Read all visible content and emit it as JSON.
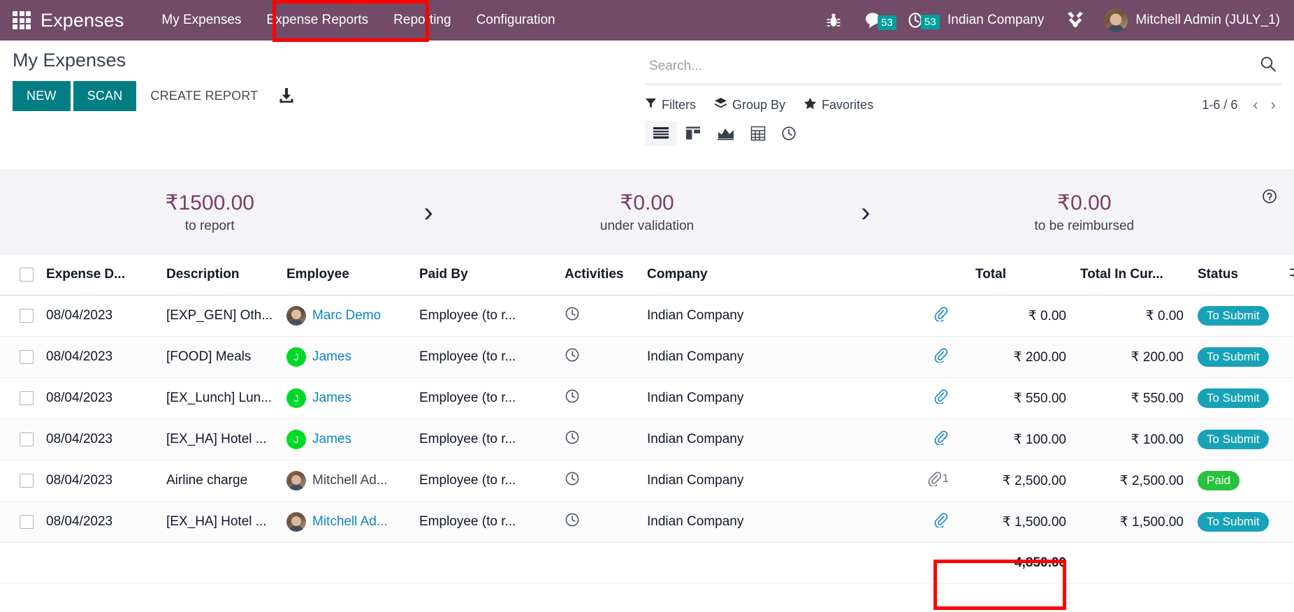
{
  "navbar": {
    "apps_icon": "apps-grid-icon",
    "brand": "Expenses",
    "menu": [
      {
        "label": "My Expenses",
        "active": false
      },
      {
        "label": "Expense Reports",
        "active": true
      },
      {
        "label": "Reporting",
        "active": false
      },
      {
        "label": "Configuration",
        "active": false
      }
    ],
    "bug_icon": "bug-icon",
    "messages": {
      "icon": "chat-bubble-icon",
      "count": "53"
    },
    "activities": {
      "icon": "clock-icon",
      "count": "53"
    },
    "company": "Indian Company",
    "tools_icon": "wrench-screwdriver-icon",
    "user": {
      "avatar": "user-avatar",
      "name": "Mitchell Admin (JULY_1)"
    }
  },
  "control_panel": {
    "title": "My Expenses",
    "buttons": {
      "new": "NEW",
      "scan": "SCAN",
      "create_report": "CREATE REPORT",
      "upload_icon": "upload-download-icon"
    },
    "search": {
      "placeholder": "Search...",
      "value": "",
      "icon": "search-icon"
    },
    "filters": [
      {
        "label": "Filters",
        "icon": "funnel-icon"
      },
      {
        "label": "Group By",
        "icon": "layers-icon"
      },
      {
        "label": "Favorites",
        "icon": "star-icon"
      }
    ],
    "pager": {
      "text": "1-6 / 6",
      "prev_icon": "chevron-left-icon",
      "next_icon": "chevron-right-icon"
    },
    "views": [
      {
        "name": "list",
        "icon": "list-view-icon",
        "active": true
      },
      {
        "name": "kanban",
        "icon": "kanban-view-icon",
        "active": false
      },
      {
        "name": "graph",
        "icon": "graph-view-icon",
        "active": false
      },
      {
        "name": "pivot",
        "icon": "pivot-view-icon",
        "active": false
      },
      {
        "name": "activity",
        "icon": "activity-view-icon",
        "active": false
      }
    ]
  },
  "stats": {
    "separator": "›",
    "help_icon": "help-circle-icon",
    "items": [
      {
        "value": "₹1500.00",
        "label": "to report"
      },
      {
        "value": "₹0.00",
        "label": "under validation"
      },
      {
        "value": "₹0.00",
        "label": "to be reimbursed"
      }
    ]
  },
  "table": {
    "headers": {
      "select_all": "select-all-checkbox",
      "date": "Expense D...",
      "description": "Description",
      "employee": "Employee",
      "paid_by": "Paid By",
      "activities": "Activities",
      "company": "Company",
      "attachments": "",
      "total": "Total",
      "total_in_currency": "Total In Cur...",
      "status": "Status",
      "options_icon": "column-options-icon"
    },
    "rows": [
      {
        "date": "08/04/2023",
        "description": "[EXP_GEN] Oth...",
        "employee": "Marc Demo",
        "employee_avatar": "photo-marc",
        "paid_by": "Employee (to r...",
        "activity_icon": "clock-icon",
        "company": "Indian Company",
        "attachment_icon": "paperclip-icon",
        "attachment_count": "",
        "total": "₹ 0.00",
        "total_in_currency": "₹ 0.00",
        "status": "To Submit",
        "status_type": "tosubmit",
        "read": false
      },
      {
        "date": "08/04/2023",
        "description": "[FOOD] Meals",
        "employee": "James",
        "employee_avatar": "initial-J",
        "paid_by": "Employee (to r...",
        "activity_icon": "clock-icon",
        "company": "Indian Company",
        "attachment_icon": "paperclip-icon",
        "attachment_count": "",
        "total": "₹ 200.00",
        "total_in_currency": "₹ 200.00",
        "status": "To Submit",
        "status_type": "tosubmit",
        "read": false
      },
      {
        "date": "08/04/2023",
        "description": "[EX_Lunch] Lun...",
        "employee": "James",
        "employee_avatar": "initial-J",
        "paid_by": "Employee (to r...",
        "activity_icon": "clock-icon",
        "company": "Indian Company",
        "attachment_icon": "paperclip-icon",
        "attachment_count": "",
        "total": "₹ 550.00",
        "total_in_currency": "₹ 550.00",
        "status": "To Submit",
        "status_type": "tosubmit",
        "read": false
      },
      {
        "date": "08/04/2023",
        "description": "[EX_HA] Hotel ...",
        "employee": "James",
        "employee_avatar": "initial-J",
        "paid_by": "Employee (to r...",
        "activity_icon": "clock-icon",
        "company": "Indian Company",
        "attachment_icon": "paperclip-icon",
        "attachment_count": "",
        "total": "₹ 100.00",
        "total_in_currency": "₹ 100.00",
        "status": "To Submit",
        "status_type": "tosubmit",
        "read": false
      },
      {
        "date": "08/04/2023",
        "description": "Airline charge",
        "employee": "Mitchell Ad...",
        "employee_avatar": "photo-mitchell",
        "paid_by": "Employee (to r...",
        "activity_icon": "clock-icon",
        "company": "Indian Company",
        "attachment_icon": "paperclip-icon",
        "attachment_count": "1",
        "total": "₹ 2,500.00",
        "total_in_currency": "₹ 2,500.00",
        "status": "Paid",
        "status_type": "paid",
        "read": true
      },
      {
        "date": "08/04/2023",
        "description": "[EX_HA] Hotel ...",
        "employee": "Mitchell Ad...",
        "employee_avatar": "photo-mitchell",
        "paid_by": "Employee (to r...",
        "activity_icon": "clock-icon",
        "company": "Indian Company",
        "attachment_icon": "paperclip-icon",
        "attachment_count": "",
        "total": "₹ 1,500.00",
        "total_in_currency": "₹ 1,500.00",
        "status": "To Submit",
        "status_type": "tosubmit",
        "read": false
      }
    ],
    "footer": {
      "total": "4,850.00",
      "total_in_currency": ""
    }
  },
  "annotations": {
    "highlight_tab": "Expense Reports",
    "highlight_total": "4,850.00",
    "color": "#FF0000"
  }
}
